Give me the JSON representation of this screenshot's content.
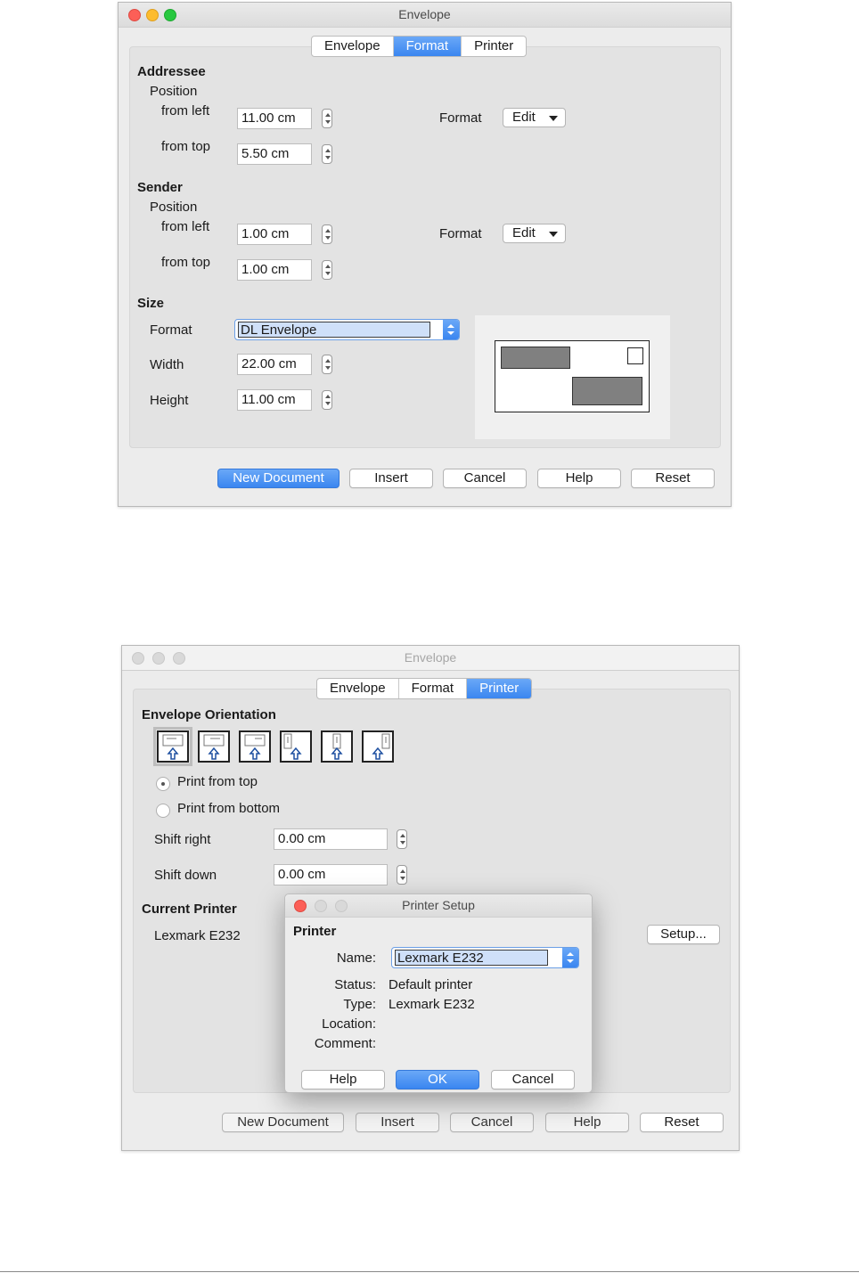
{
  "window1": {
    "title": "Envelope",
    "tabs": [
      {
        "label": "Envelope",
        "active": false
      },
      {
        "label": "Format",
        "active": true
      },
      {
        "label": "Printer",
        "active": false
      }
    ],
    "addressee": {
      "heading": "Addressee",
      "position_label": "Position",
      "from_left_label": "from left",
      "from_left_value": "11.00 cm",
      "from_top_label": "from top",
      "from_top_value": "5.50 cm",
      "format_label": "Format",
      "edit_label": "Edit"
    },
    "sender": {
      "heading": "Sender",
      "position_label": "Position",
      "from_left_label": "from left",
      "from_left_value": "1.00 cm",
      "from_top_label": "from top",
      "from_top_value": "1.00 cm",
      "format_label": "Format",
      "edit_label": "Edit"
    },
    "size": {
      "heading": "Size",
      "format_label": "Format",
      "format_value": "DL Envelope",
      "width_label": "Width",
      "width_value": "22.00 cm",
      "height_label": "Height",
      "height_value": "11.00 cm"
    },
    "buttons": {
      "new_document": "New Document",
      "insert": "Insert",
      "cancel": "Cancel",
      "help": "Help",
      "reset": "Reset"
    },
    "colors": {
      "accent": "#3a86f0",
      "preview_box": "#808080"
    }
  },
  "window2": {
    "title": "Envelope",
    "tabs": [
      {
        "label": "Envelope",
        "active": false
      },
      {
        "label": "Format",
        "active": false
      },
      {
        "label": "Printer",
        "active": true
      }
    ],
    "orientation": {
      "heading": "Envelope Orientation",
      "print_from_top": "Print from top",
      "print_from_bottom": "Print from bottom",
      "selected": "Print from top"
    },
    "shift_right_label": "Shift right",
    "shift_right_value": "0.00 cm",
    "shift_down_label": "Shift down",
    "shift_down_value": "0.00 cm",
    "current_printer_heading": "Current Printer",
    "current_printer_name": "Lexmark E232",
    "setup_button": "Setup...",
    "buttons": {
      "new_document": "New Document",
      "insert": "Insert",
      "cancel": "Cancel",
      "help": "Help",
      "reset": "Reset"
    }
  },
  "printer_setup": {
    "title": "Printer Setup",
    "heading": "Printer",
    "name_label": "Name:",
    "name_value": "Lexmark E232",
    "status_label": "Status:",
    "status_value": "Default printer",
    "type_label": "Type:",
    "type_value": "Lexmark E232",
    "location_label": "Location:",
    "comment_label": "Comment:",
    "buttons": {
      "help": "Help",
      "ok": "OK",
      "cancel": "Cancel"
    }
  }
}
